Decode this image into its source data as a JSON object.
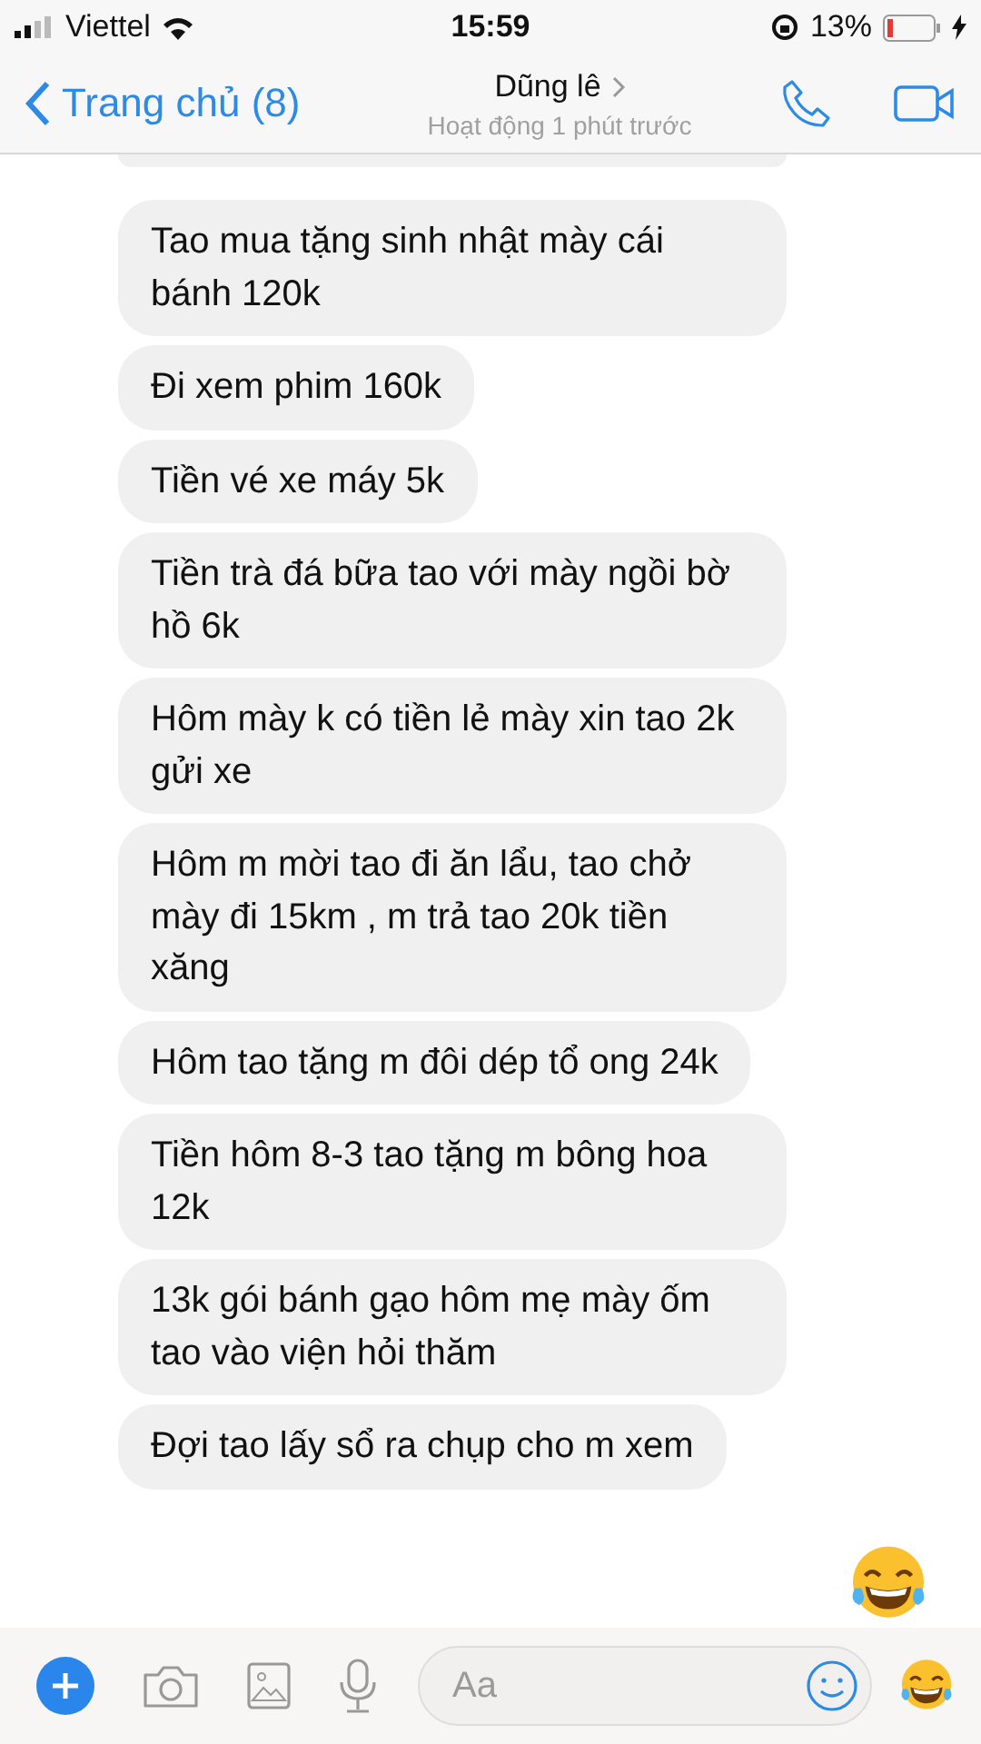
{
  "status_bar": {
    "carrier": "Viettel",
    "time": "15:59",
    "battery": "13%"
  },
  "header": {
    "back": "Trang chủ (8)",
    "name": "Dũng lê",
    "status": "Hoạt động 1 phút trước"
  },
  "messages": [
    {
      "kind": "text",
      "text": "Tao mua tặng sinh nhật mày cái bánh 120k"
    },
    {
      "kind": "text",
      "text": "Đi xem phim 160k"
    },
    {
      "kind": "text",
      "text": "Tiền vé xe máy 5k"
    },
    {
      "kind": "text",
      "text": "Tiền trà đá bữa tao với mày ngồi bờ hồ 6k"
    },
    {
      "kind": "text",
      "text": "Hôm mày k có tiền lẻ mày xin tao 2k gửi xe"
    },
    {
      "kind": "text",
      "text": "Hôm m mời tao đi ăn lẩu, tao chở mày đi 15km , m trả tao 20k tiền xăng"
    },
    {
      "kind": "text",
      "text": "Hôm tao tặng m đôi dép tổ ong 24k"
    },
    {
      "kind": "text",
      "text": "Tiền hôm 8-3 tao tặng m bông hoa 12k"
    },
    {
      "kind": "text",
      "text": "13k gói bánh gạo hôm mẹ mày ốm tao vào viện hỏi thăm"
    },
    {
      "kind": "text",
      "text": "Đợi tao lấy sổ ra chụp cho m xem"
    },
    {
      "kind": "emoji"
    }
  ],
  "composer": {
    "placeholder": "Aa"
  }
}
